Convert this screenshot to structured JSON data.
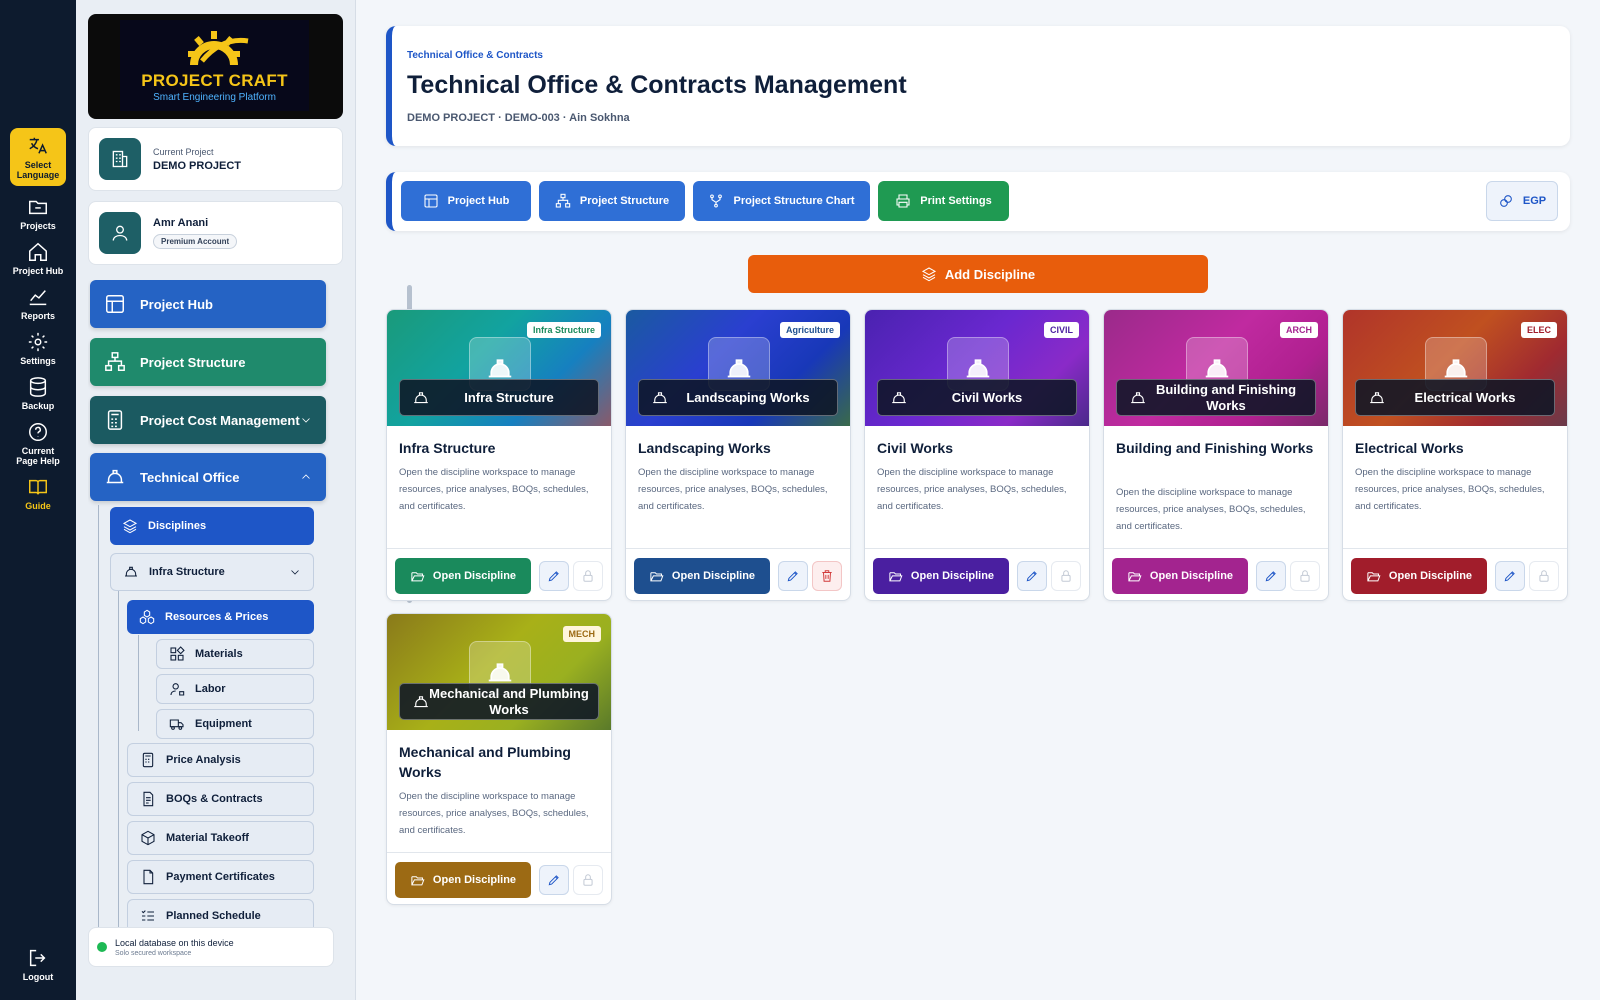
{
  "rail": {
    "items": [
      {
        "label": "Select Language",
        "icon": "translate-icon"
      },
      {
        "label": "Projects",
        "icon": "folder-icon"
      },
      {
        "label": "Project Hub",
        "icon": "home-icon"
      },
      {
        "label": "Reports",
        "icon": "chart-line-icon"
      },
      {
        "label": "Settings",
        "icon": "gear-icon"
      },
      {
        "label": "Backup",
        "icon": "database-icon"
      },
      {
        "label": "Current Page Help",
        "icon": "help-icon"
      },
      {
        "label": "Guide",
        "icon": "book-icon"
      }
    ],
    "logout": "Logout"
  },
  "brand": {
    "title": "PROJECT CRAFT",
    "subtitle": "Smart Engineering Platform"
  },
  "current_project": {
    "caption": "Current Project",
    "name": "DEMO PROJECT"
  },
  "user": {
    "name": "Amr Anani",
    "badge": "Premium Account"
  },
  "nav": {
    "project_hub": "Project Hub",
    "project_structure": "Project Structure",
    "cost_management": "Project Cost Management",
    "technical_office": "Technical Office",
    "disciplines": "Disciplines",
    "infra_structure": "Infra Structure",
    "resources_prices": "Resources & Prices",
    "materials": "Materials",
    "labor": "Labor",
    "equipment": "Equipment",
    "price_analysis": "Price Analysis",
    "boqs_contracts": "BOQs & Contracts",
    "material_takeoff": "Material Takeoff",
    "payment_certificates": "Payment Certificates",
    "planned_schedule": "Planned Schedule"
  },
  "status": {
    "line1": "Local database on this device",
    "line2": "Solo secured workspace",
    "color": "#1db954"
  },
  "header": {
    "breadcrumb": "Technical Office & Contracts",
    "title": "Technical Office & Contracts Management",
    "meta": "DEMO PROJECT · DEMO-003 · Ain Sokhna"
  },
  "toolbar": {
    "project_hub": "Project Hub",
    "project_structure": "Project Structure",
    "structure_chart": "Project Structure Chart",
    "print_settings": "Print Settings",
    "currency": "EGP"
  },
  "add_discipline": "Add Discipline",
  "common": {
    "description": "Open the discipline workspace to manage resources, price analyses, BOQs, schedules, and certificates.",
    "open_label": "Open Discipline"
  },
  "disciplines": [
    {
      "badge": "Infra Structure",
      "banner_label": "Infra Structure",
      "title": "Infra Structure",
      "accent": "#1a8a5c"
    },
    {
      "badge": "Agriculture",
      "banner_label": "Landscaping Works",
      "title": "Landscaping Works",
      "accent": "#1e4f8f"
    },
    {
      "badge": "CIVIL",
      "banner_label": "Civil Works",
      "title": "Civil Works",
      "accent": "#4a1fa0"
    },
    {
      "badge": "ARCH",
      "banner_label": "Building and Finishing Works",
      "title": "Building and Finishing Works",
      "accent": "#a3248f"
    },
    {
      "badge": "ELEC",
      "banner_label": "Electrical Works",
      "title": "Electrical Works",
      "accent": "#a11d2b"
    },
    {
      "badge": "MECH",
      "banner_label": "Mechanical and Plumbing Works",
      "title": "Mechanical and Plumbing Works",
      "accent": "#9c6a14"
    }
  ]
}
